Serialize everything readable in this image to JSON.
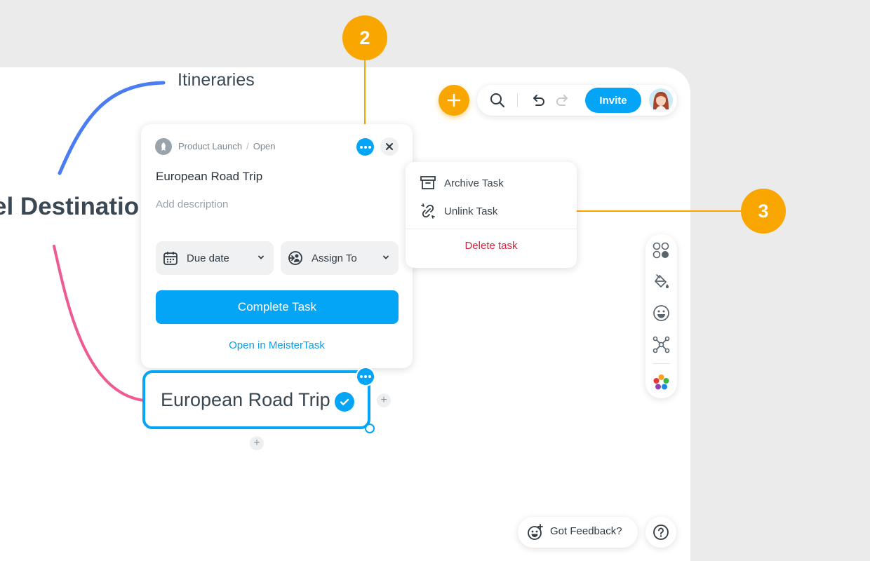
{
  "mindmap": {
    "root_label": "el Destinatio",
    "branch_label": "Itineraries",
    "node": {
      "label": "European Road Trip",
      "add_symbol": "+"
    }
  },
  "toolbar": {
    "add_icon": "plus-icon",
    "invite_label": "Invite"
  },
  "task_card": {
    "project": "Product Launch",
    "separator": "/",
    "status": "Open",
    "title": "European Road Trip",
    "description_placeholder": "Add description",
    "due_date_label": "Due date",
    "assign_label": "Assign To",
    "complete_label": "Complete Task",
    "open_link": "Open in MeisterTask"
  },
  "menu": {
    "archive_label": "Archive Task",
    "unlink_label": "Unlink Task",
    "delete_label": "Delete task"
  },
  "sidepanel": {
    "icons": [
      "shapes-icon",
      "paint-bucket-icon",
      "emoji-icon",
      "layout-icon",
      "colors-flower-icon"
    ]
  },
  "footer": {
    "feedback_label": "Got Feedback?",
    "help_symbol": "?"
  },
  "callouts": {
    "two": "2",
    "three": "3"
  },
  "colors": {
    "accent": "#04a5f6",
    "orange": "#f9a600",
    "delete": "#d0253f"
  }
}
